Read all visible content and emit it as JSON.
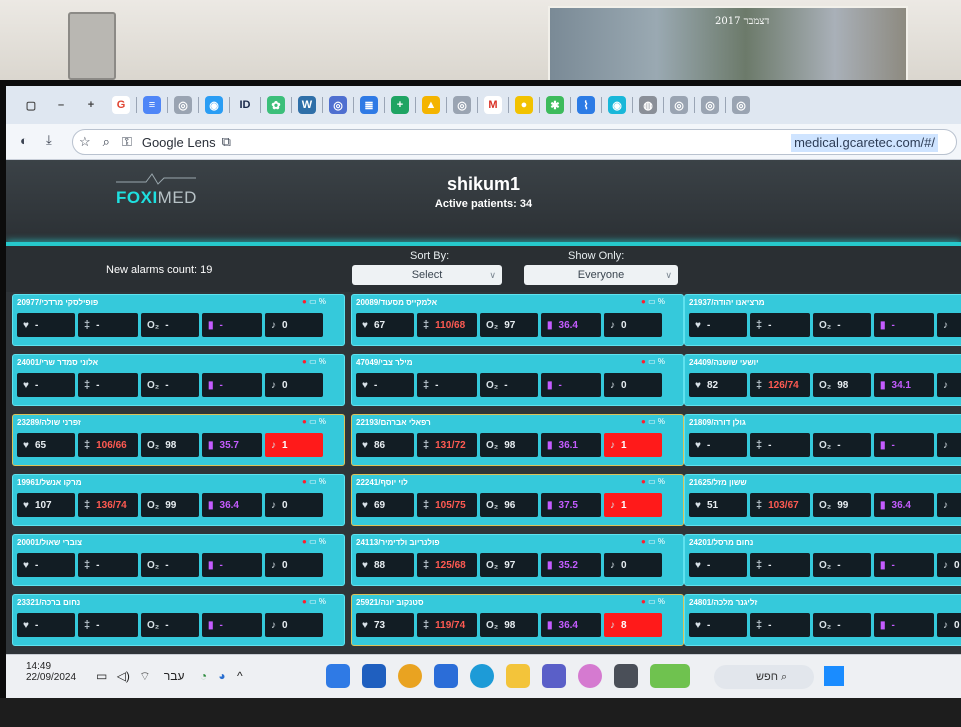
{
  "wall": {
    "photo_text": "2017 דצמבר"
  },
  "browser": {
    "tab_icons": [
      {
        "name": "window-icon",
        "label": "▢",
        "color": "#dfe7f1",
        "fg": "#444"
      },
      {
        "name": "minimize-icon",
        "label": "–",
        "color": "#dfe7f1",
        "fg": "#444"
      },
      {
        "name": "new-tab-icon",
        "label": "+",
        "color": "#dfe7f1",
        "fg": "#444"
      },
      {
        "name": "google-icon",
        "label": "G",
        "color": "#ffffff",
        "fg": "#e0422f"
      },
      {
        "name": "docs-icon",
        "label": "≡",
        "color": "#4f86f7",
        "fg": "#fff"
      },
      {
        "name": "chrome-icon",
        "label": "◎",
        "color": "#9aa4b2",
        "fg": "#fff"
      },
      {
        "name": "site-icon",
        "label": "◉",
        "color": "#2a9df4",
        "fg": "#fff"
      },
      {
        "name": "id-icon",
        "label": "ID",
        "color": "#dfe7f1",
        "fg": "#1a2a4a"
      },
      {
        "name": "app-icon",
        "label": "✿",
        "color": "#3cbf7a",
        "fg": "#fff"
      },
      {
        "name": "wordpress-icon",
        "label": "W",
        "color": "#2f6fa8",
        "fg": "#fff"
      },
      {
        "name": "circle-icon",
        "label": "◎",
        "color": "#4f6fd0",
        "fg": "#fff"
      },
      {
        "name": "forms-icon",
        "label": "≣",
        "color": "#2f7ae5",
        "fg": "#fff"
      },
      {
        "name": "sheets-icon",
        "label": "+",
        "color": "#1fa463",
        "fg": "#fff"
      },
      {
        "name": "drive-icon",
        "label": "▲",
        "color": "#f4b400",
        "fg": "#fff"
      },
      {
        "name": "chrome2-icon",
        "label": "◎",
        "color": "#9aa4b2",
        "fg": "#fff"
      },
      {
        "name": "gmail-icon",
        "label": "M",
        "color": "#ffffff",
        "fg": "#d93025"
      },
      {
        "name": "yellow-icon",
        "label": "●",
        "color": "#f2c200",
        "fg": "#fff"
      },
      {
        "name": "green-icon",
        "label": "✱",
        "color": "#3dbb5c",
        "fg": "#fff"
      },
      {
        "name": "pulse-icon",
        "label": "⌇",
        "color": "#2c7be5",
        "fg": "#fff"
      },
      {
        "name": "cyan-icon",
        "label": "◉",
        "color": "#19b7d9",
        "fg": "#fff"
      },
      {
        "name": "grey-icon",
        "label": "◍",
        "color": "#8a8f98",
        "fg": "#fff"
      },
      {
        "name": "chrome3-icon",
        "label": "◎",
        "color": "#9aa4b2",
        "fg": "#fff"
      },
      {
        "name": "chrome4-icon",
        "label": "◎",
        "color": "#9aa4b2",
        "fg": "#fff"
      },
      {
        "name": "chrome5-icon",
        "label": "◎",
        "color": "#9aa4b2",
        "fg": "#fff"
      }
    ],
    "lens_label": "Google Lens",
    "url": "medical.gcaretec.com/#/"
  },
  "app": {
    "logo_a": "FOXI",
    "logo_b": "MED",
    "site_name": "shikum1",
    "active_patients": "Active patients: 34",
    "new_alarms": "New alarms count: 19",
    "sort_label": "Sort By:",
    "sort_value": "Select",
    "show_label": "Show Only:",
    "show_value": "Everyone",
    "battery_pct": "%",
    "columns": [
      [
        {
          "name": "פופילסקי מרדכי/20977",
          "hr": "-",
          "bp": "-",
          "o2": "-",
          "temp": "-",
          "alarms": "0",
          "state": "normal"
        },
        {
          "name": "אלוני סמדר שרי/24001",
          "hr": "-",
          "bp": "-",
          "o2": "-",
          "temp": "-",
          "alarms": "0",
          "state": "normal"
        },
        {
          "name": "זפרני שולה/23289",
          "hr": "65",
          "bp": "106/66",
          "o2": "98",
          "temp": "35.7",
          "alarms": "1",
          "state": "alarm"
        },
        {
          "name": "מרקו אנשל/19961",
          "hr": "107",
          "bp": "136/74",
          "o2": "99",
          "temp": "36.4",
          "alarms": "0",
          "state": "normal"
        },
        {
          "name": "צוברי שאול/20001",
          "hr": "-",
          "bp": "-",
          "o2": "-",
          "temp": "-",
          "alarms": "0",
          "state": "normal"
        },
        {
          "name": "נחום ברכה/23321",
          "hr": "-",
          "bp": "-",
          "o2": "-",
          "temp": "-",
          "alarms": "0",
          "state": "normal"
        }
      ],
      [
        {
          "name": "אלמקייס מסעוד/20089",
          "hr": "67",
          "bp": "110/68",
          "o2": "97",
          "temp": "36.4",
          "alarms": "0",
          "state": "normal"
        },
        {
          "name": "מילר צבי/47049",
          "hr": "-",
          "bp": "-",
          "o2": "-",
          "temp": "-",
          "alarms": "0",
          "state": "normal"
        },
        {
          "name": "רפאלי אברהם/22193",
          "hr": "86",
          "bp": "131/72",
          "o2": "98",
          "temp": "36.1",
          "alarms": "1",
          "state": "alarm"
        },
        {
          "name": "לוי יוסף/22241",
          "hr": "69",
          "bp": "105/75",
          "o2": "96",
          "temp": "37.5",
          "alarms": "1",
          "state": "alarm"
        },
        {
          "name": "פולנריוב ולדימיר/24113",
          "hr": "88",
          "bp": "125/68",
          "o2": "97",
          "temp": "35.2",
          "alarms": "0",
          "state": "normal"
        },
        {
          "name": "סטנקוב יונה/25921",
          "hr": "73",
          "bp": "119/74",
          "o2": "98",
          "temp": "36.4",
          "alarms": "8",
          "state": "alarm"
        }
      ],
      [
        {
          "name": "מרציאנו יהודה/21937",
          "hr": "-",
          "bp": "-",
          "o2": "-",
          "temp": "-",
          "alarms": "",
          "state": "normal"
        },
        {
          "name": "יושעי שושנה/24409",
          "hr": "82",
          "bp": "126/74",
          "o2": "98",
          "temp": "34.1",
          "alarms": "",
          "state": "normal"
        },
        {
          "name": "גולן דורה/21809",
          "hr": "-",
          "bp": "-",
          "o2": "-",
          "temp": "-",
          "alarms": "",
          "state": "normal"
        },
        {
          "name": "ששון מזל/21625",
          "hr": "51",
          "bp": "103/67",
          "o2": "99",
          "temp": "36.4",
          "alarms": "",
          "state": "normal"
        },
        {
          "name": "נחום מרסל/24201",
          "hr": "-",
          "bp": "-",
          "o2": "-",
          "temp": "-",
          "alarms": "0",
          "state": "normal"
        },
        {
          "name": "זליגנר מלכה/24801",
          "hr": "-",
          "bp": "-",
          "o2": "-",
          "temp": "-",
          "alarms": "0",
          "state": "normal"
        }
      ]
    ]
  },
  "taskbar": {
    "time": "14:49",
    "date": "22/09/2024",
    "lang": "עבר",
    "search": "חפש"
  }
}
